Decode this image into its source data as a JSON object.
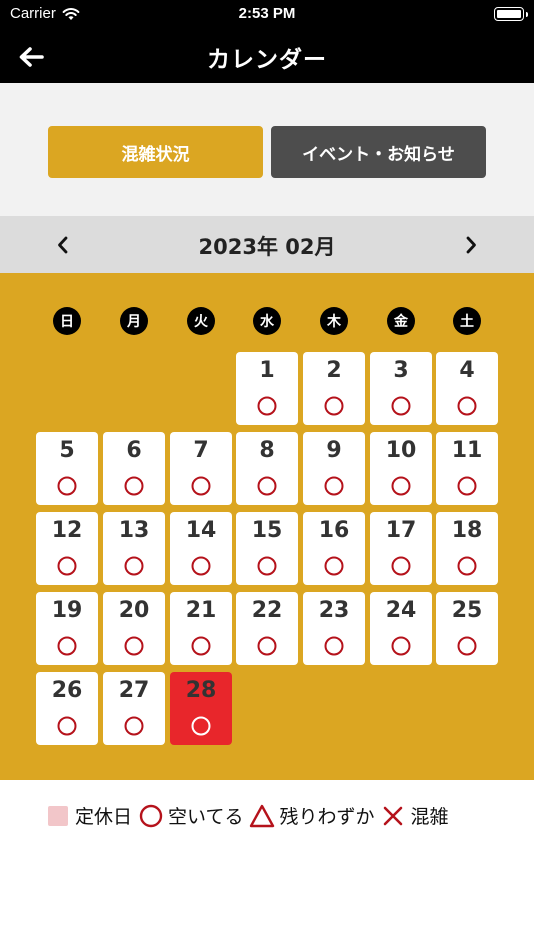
{
  "status_bar": {
    "carrier": "Carrier",
    "time": "2:53 PM"
  },
  "nav": {
    "title": "カレンダー"
  },
  "tabs": [
    {
      "label": "混雑状況",
      "active": true
    },
    {
      "label": "イベント・お知らせ",
      "active": false
    }
  ],
  "month": {
    "label": "2023年 02月"
  },
  "weekdays": [
    "日",
    "月",
    "火",
    "水",
    "木",
    "金",
    "土"
  ],
  "calendar": {
    "first_weekday_index": 3,
    "today": 28,
    "days": [
      {
        "day": "1",
        "status": "open"
      },
      {
        "day": "2",
        "status": "open"
      },
      {
        "day": "3",
        "status": "open"
      },
      {
        "day": "4",
        "status": "open"
      },
      {
        "day": "5",
        "status": "open"
      },
      {
        "day": "6",
        "status": "open"
      },
      {
        "day": "7",
        "status": "open"
      },
      {
        "day": "8",
        "status": "open"
      },
      {
        "day": "9",
        "status": "open"
      },
      {
        "day": "10",
        "status": "open"
      },
      {
        "day": "11",
        "status": "open"
      },
      {
        "day": "12",
        "status": "open"
      },
      {
        "day": "13",
        "status": "open"
      },
      {
        "day": "14",
        "status": "open"
      },
      {
        "day": "15",
        "status": "open"
      },
      {
        "day": "16",
        "status": "open"
      },
      {
        "day": "17",
        "status": "open"
      },
      {
        "day": "18",
        "status": "open"
      },
      {
        "day": "19",
        "status": "open"
      },
      {
        "day": "20",
        "status": "open"
      },
      {
        "day": "21",
        "status": "open"
      },
      {
        "day": "22",
        "status": "open"
      },
      {
        "day": "23",
        "status": "open"
      },
      {
        "day": "24",
        "status": "open"
      },
      {
        "day": "25",
        "status": "open"
      },
      {
        "day": "26",
        "status": "open"
      },
      {
        "day": "27",
        "status": "open"
      },
      {
        "day": "28",
        "status": "open"
      }
    ]
  },
  "legend": {
    "closed": "定休日",
    "open": "空いてる",
    "few_left": "残りわずか",
    "crowded": "混雑"
  },
  "colors": {
    "accent": "#dba622",
    "tab_inactive": "#4d4d4d",
    "today": "#e8262b",
    "status_mark": "#b5121b",
    "closed_swatch": "#f2c6c9"
  }
}
